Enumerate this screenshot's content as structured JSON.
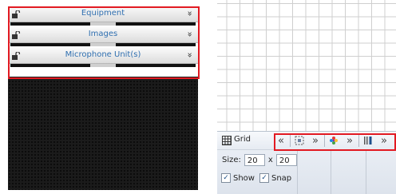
{
  "accordion": {
    "items": [
      {
        "title": "Equipment"
      },
      {
        "title": "Images"
      },
      {
        "title": "Microphone Unit(s)"
      }
    ]
  },
  "grid_panel": {
    "title": "Grid",
    "toolbar": {
      "collapse_left": "«",
      "expand_right_1": "»",
      "expand_right_2": "»",
      "expand_right_3": "»"
    },
    "size_label": "Size:",
    "width_value": "20",
    "times": "x",
    "height_value": "20",
    "show_label": "Show",
    "snap_label": "Snap",
    "show_checked": true,
    "snap_checked": true,
    "check_glyph": "✓"
  },
  "colors": {
    "highlight": "#e21a22",
    "accordion_title": "#2f6fb0"
  }
}
